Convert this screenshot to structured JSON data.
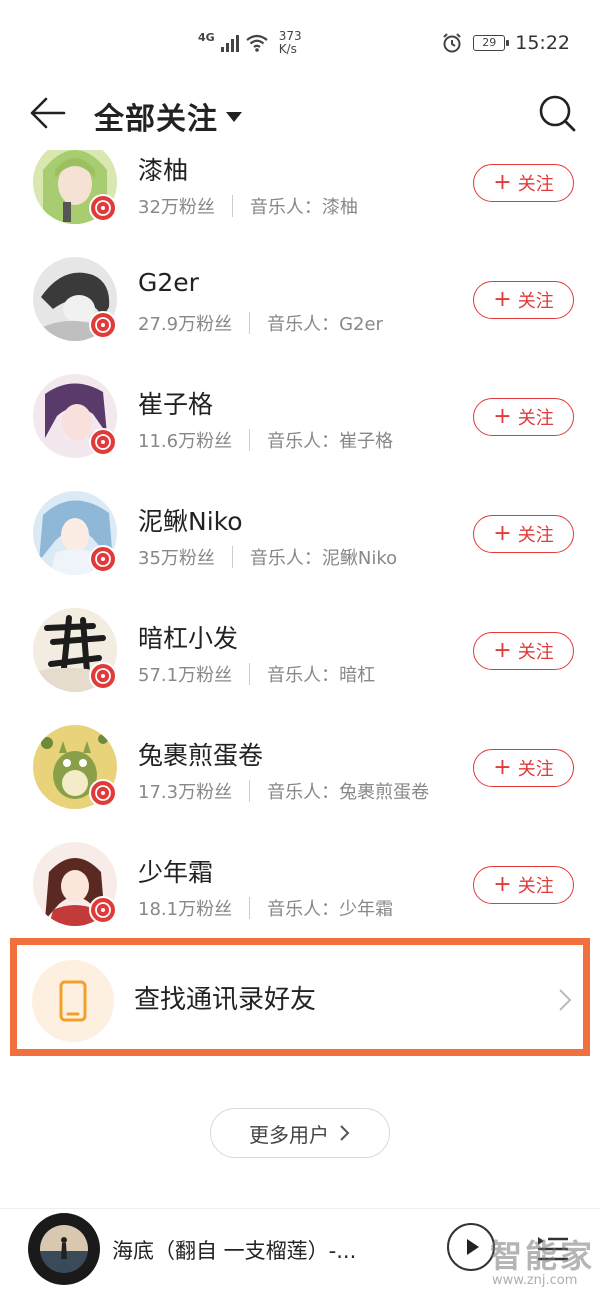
{
  "status_bar": {
    "network": "4G",
    "speed_value": "373",
    "speed_unit": "K/s",
    "battery": "29",
    "time": "15:22"
  },
  "header": {
    "title": "全部关注"
  },
  "follow_label": "关注",
  "users": [
    {
      "name": "漆柚",
      "fans": "32万粉丝",
      "artist": "音乐人：漆柚"
    },
    {
      "name": "G2er",
      "fans": "27.9万粉丝",
      "artist": "音乐人：G2er"
    },
    {
      "name": "崔子格",
      "fans": "11.6万粉丝",
      "artist": "音乐人：崔子格"
    },
    {
      "name": "泥鳅Niko",
      "fans": "35万粉丝",
      "artist": "音乐人：泥鳅Niko"
    },
    {
      "name": "暗杠小发",
      "fans": "57.1万粉丝",
      "artist": "音乐人：暗杠"
    },
    {
      "name": "兔裹煎蛋卷",
      "fans": "17.3万粉丝",
      "artist": "音乐人：兔裹煎蛋卷"
    },
    {
      "name": "少年霜",
      "fans": "18.1万粉丝",
      "artist": "音乐人：少年霜"
    }
  ],
  "contacts": {
    "label": "查找通讯录好友"
  },
  "more_users": {
    "label": "更多用户"
  },
  "player": {
    "song": "海底（翻自 一支榴莲）-..."
  },
  "watermark": {
    "text": "智能家",
    "url": "www.znj.com"
  }
}
